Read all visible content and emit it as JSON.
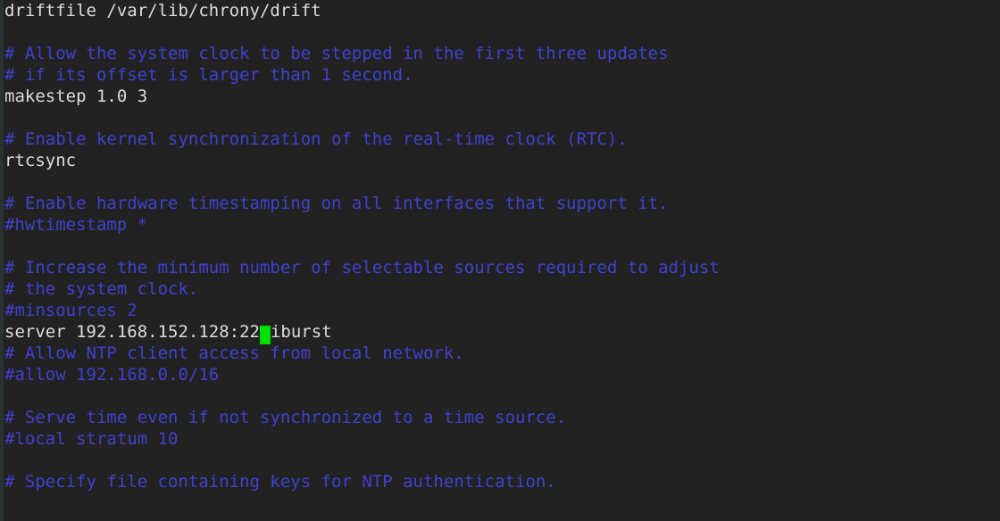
{
  "terminal": {
    "background_color": "#222222",
    "comment_color": "#4040d0",
    "code_color": "#dcdcdc",
    "cursor_color": "#00e000",
    "gutter_color": "#2b3234"
  },
  "lines": [
    {
      "text": "driftfile /var/lib/chrony/drift",
      "kind": "code"
    },
    {
      "text": "",
      "kind": "blank"
    },
    {
      "text": "# Allow the system clock to be stepped in the first three updates",
      "kind": "comment"
    },
    {
      "text": "# if its offset is larger than 1 second.",
      "kind": "comment"
    },
    {
      "text": "makestep 1.0 3",
      "kind": "code"
    },
    {
      "text": "",
      "kind": "blank"
    },
    {
      "text": "# Enable kernel synchronization of the real-time clock (RTC).",
      "kind": "comment"
    },
    {
      "text": "rtcsync",
      "kind": "code"
    },
    {
      "text": "",
      "kind": "blank"
    },
    {
      "text": "# Enable hardware timestamping on all interfaces that support it.",
      "kind": "comment"
    },
    {
      "text": "#hwtimestamp *",
      "kind": "comment"
    },
    {
      "text": "",
      "kind": "blank"
    },
    {
      "text": "# Increase the minimum number of selectable sources required to adjust",
      "kind": "comment"
    },
    {
      "text": "# the system clock.",
      "kind": "comment"
    },
    {
      "text": "#minsources 2",
      "kind": "comment"
    },
    {
      "text": "server 192.168.152.128:22 iburst",
      "kind": "cursor",
      "before_cursor": "server 192.168.152.128:22",
      "after_cursor": "iburst"
    },
    {
      "text": "# Allow NTP client access from local network.",
      "kind": "comment"
    },
    {
      "text": "#allow 192.168.0.0/16",
      "kind": "comment"
    },
    {
      "text": "",
      "kind": "blank"
    },
    {
      "text": "# Serve time even if not synchronized to a time source.",
      "kind": "comment"
    },
    {
      "text": "#local stratum 10",
      "kind": "comment"
    },
    {
      "text": "",
      "kind": "blank"
    },
    {
      "text": "# Specify file containing keys for NTP authentication.",
      "kind": "comment"
    }
  ]
}
